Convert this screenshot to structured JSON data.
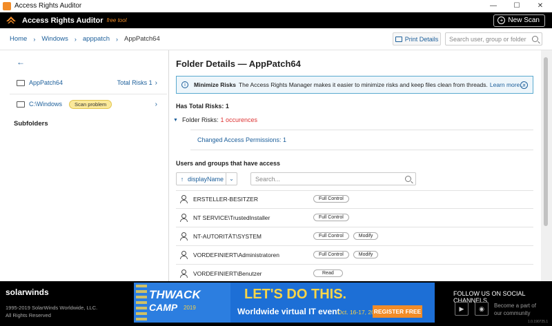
{
  "window": {
    "title": "Access Rights Auditor",
    "controls": [
      "—",
      "☐",
      "✕"
    ]
  },
  "appbar": {
    "name": "Access Rights Auditor",
    "tag": "free tool",
    "new_scan": "New Scan"
  },
  "breadcrumb": [
    "Home",
    "Windows",
    "apppatch",
    "AppPatch64"
  ],
  "print_label": "Print Details",
  "top_search_placeholder": "Search user, group or folder",
  "left": {
    "rows": [
      {
        "label": "AppPatch64",
        "risk": "Total Risks 1"
      },
      {
        "label": "C:\\Windows",
        "badge": "Scan problem"
      }
    ],
    "subfolders": "Subfolders"
  },
  "main": {
    "title": "Folder Details — AppPatch64",
    "info": {
      "strong": "Minimize Risks",
      "text": "The Access Rights Manager makes it easier to minimize risks and keep files clean from threads.",
      "link": "Learn more..."
    },
    "has_total_risks": "Has Total Risks: 1",
    "folder_risks_label": "Folder Risks:",
    "folder_risks_count": "1 occurences",
    "changed_permissions": "Changed Access Permissions: 1",
    "users_heading": "Users and groups that have access",
    "sort_label": "displayName",
    "user_search_placeholder": "Search...",
    "users": [
      {
        "name": "ERSTELLER-BESITZER",
        "perms": [
          "Full Control"
        ]
      },
      {
        "name": "NT SERVICE\\TrustedInstaller",
        "perms": [
          "Full Control"
        ]
      },
      {
        "name": "NT-AUTORITÄT\\SYSTEM",
        "perms": [
          "Full Control",
          "Modify"
        ]
      },
      {
        "name": "VORDEFINIERT\\Administratoren",
        "perms": [
          "Full Control",
          "Modify"
        ]
      },
      {
        "name": "VORDEFINIERT\\Benutzer",
        "perms": [
          "Read"
        ]
      }
    ]
  },
  "footer": {
    "brand": "solarwinds",
    "copyright_1": "1995-2019 SolarWinds Worldwide, LLC.",
    "copyright_2": "All Rights Reserved",
    "banner": {
      "thwack": "THWACK",
      "camp": "CAMP",
      "year": "2019",
      "headline": "LET'S DO THIS.",
      "sub": "Worldwide virtual IT event",
      "date": "Oct. 16-17, 2019",
      "register": "REGISTER FREE"
    },
    "follow": "FOLLOW US ON SOCIAL CHANNELS",
    "community_1": "Become a part of",
    "community_2": "our community",
    "version": "1.0.190725.1"
  },
  "colors": {
    "accent": "#1b5e9a",
    "brand_orange": "#f28c28",
    "header_bg": "#000000",
    "info_bg": "#eef6fb"
  }
}
